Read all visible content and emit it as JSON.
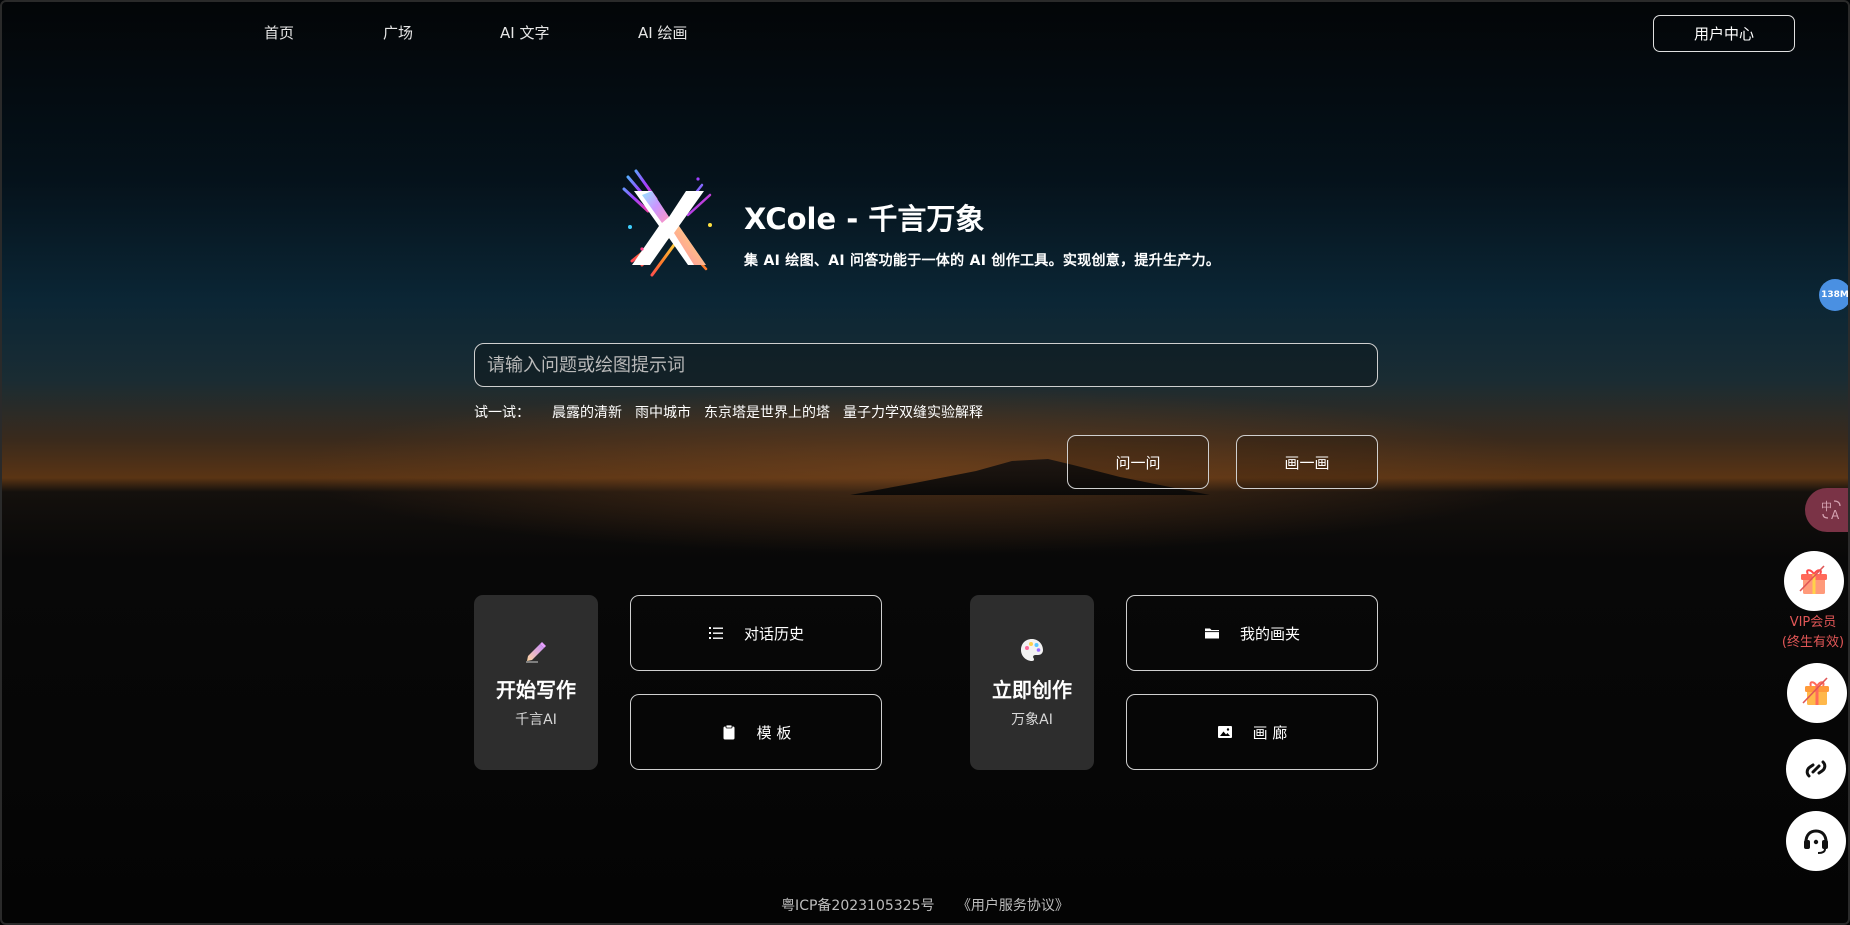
{
  "nav": {
    "items": [
      {
        "label": "首页"
      },
      {
        "label": "广场"
      },
      {
        "label": "AI 文字"
      },
      {
        "label": "AI 绘画"
      }
    ],
    "user_center": "用户中心"
  },
  "hero": {
    "title": "XCole - 千言万象",
    "subtitle": "集 AI 绘图、AI 问答功能于一体的 AI 创作工具。实现创意，提升生产力。"
  },
  "search": {
    "placeholder": "请输入问题或绘图提示词",
    "value": ""
  },
  "suggestions": {
    "label": "试一试：",
    "items": [
      "晨露的清新",
      "雨中城市",
      "东京塔是世界上的塔",
      "量子力学双缝实验解释"
    ]
  },
  "actions": {
    "ask": "问一问",
    "draw": "画一画"
  },
  "writing": {
    "title": "开始写作",
    "subtitle": "千言AI",
    "icon": "pencil-icon",
    "history": "对话历史",
    "templates": "模 板"
  },
  "creation": {
    "title": "立即创作",
    "subtitle": "万象AI",
    "icon": "palette-icon",
    "folder": "我的画夹",
    "gallery": "画 廊"
  },
  "footer": {
    "icp": "粤ICP备2023105325号",
    "agreement": "《用户服务协议》"
  },
  "side": {
    "memory_badge": "138M",
    "vip_line1": "VIP会员",
    "vip_line2": "(终生有效)"
  },
  "colors": {
    "accent_red": "#e05656",
    "badge_blue": "#4a90e2",
    "card_bg": "#2d2d2d"
  }
}
